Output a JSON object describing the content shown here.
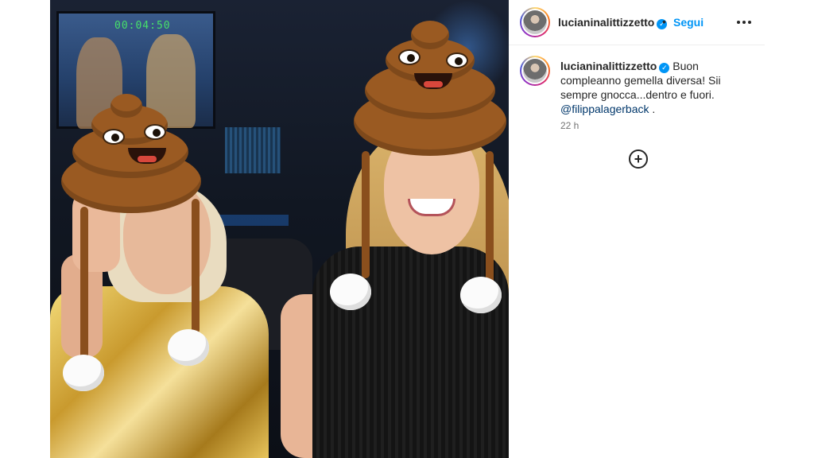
{
  "post": {
    "image_alt_icon": "photo",
    "monitor_clock": "00:04:50"
  },
  "header": {
    "username": "lucianinalittizzetto",
    "verified_icon": "verified-badge-icon",
    "separator": "•",
    "follow_label": "Segui",
    "more_icon": "more-options-icon"
  },
  "caption": {
    "username": "lucianinalittizzetto",
    "text": "Buon compleanno gemella diversa! Sii sempre gnocca...dentro e fuori.",
    "mention": "@filippalagerback",
    "trailing": " .",
    "timestamp": "22 h"
  },
  "load_more": {
    "icon": "plus-circle-icon",
    "glyph": "+"
  },
  "colors": {
    "accent": "#0095f6",
    "mention": "#00376b",
    "muted": "#737373"
  }
}
